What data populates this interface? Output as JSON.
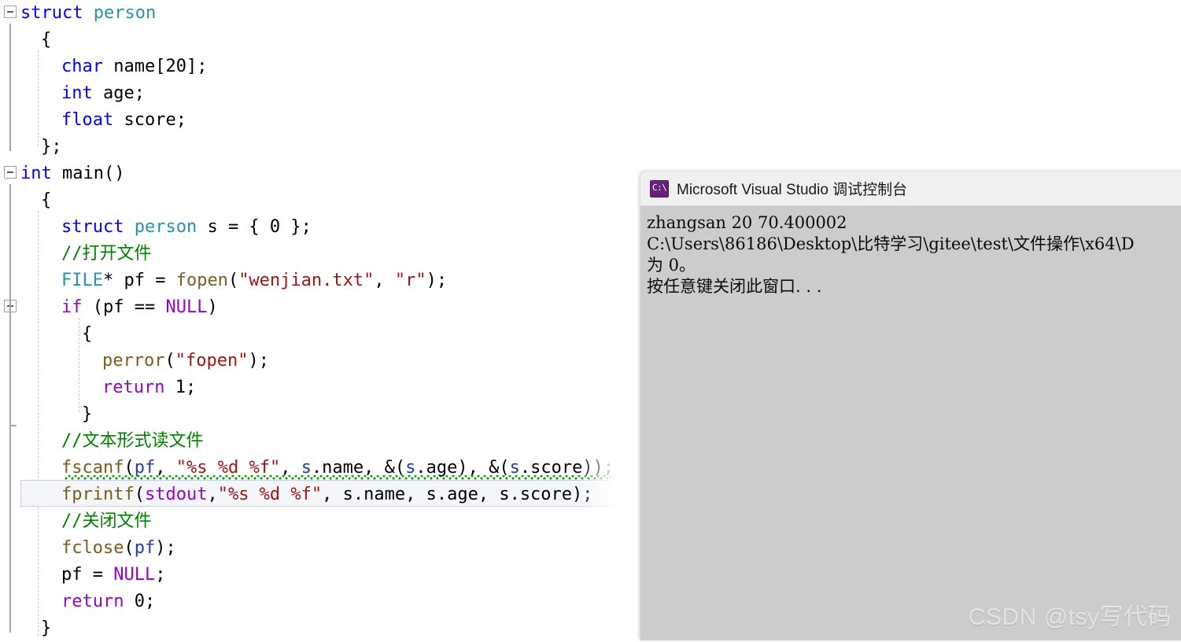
{
  "editor": {
    "name": "visual-studio-code-editor",
    "background": "#ffffff",
    "font_size_px": 22,
    "line_height_px": 34,
    "lines": [
      {
        "indent": 0,
        "tokens": [
          {
            "t": "struct ",
            "c": "kw"
          },
          {
            "t": "person",
            "c": "type"
          }
        ]
      },
      {
        "indent": 1,
        "tokens": [
          {
            "t": "{",
            "c": "plain"
          }
        ]
      },
      {
        "indent": 2,
        "tokens": [
          {
            "t": "char ",
            "c": "kw"
          },
          {
            "t": "name[",
            "c": "plain"
          },
          {
            "t": "20",
            "c": "num"
          },
          {
            "t": "];",
            "c": "plain"
          }
        ]
      },
      {
        "indent": 2,
        "tokens": [
          {
            "t": "int ",
            "c": "kw"
          },
          {
            "t": "age;",
            "c": "plain"
          }
        ]
      },
      {
        "indent": 2,
        "tokens": [
          {
            "t": "float ",
            "c": "kw"
          },
          {
            "t": "score;",
            "c": "plain"
          }
        ]
      },
      {
        "indent": 1,
        "tokens": [
          {
            "t": "};",
            "c": "plain"
          }
        ]
      },
      {
        "indent": 0,
        "tokens": [
          {
            "t": "int ",
            "c": "kw"
          },
          {
            "t": "main",
            "c": "plain"
          },
          {
            "t": "()",
            "c": "plain"
          }
        ]
      },
      {
        "indent": 1,
        "tokens": [
          {
            "t": "{",
            "c": "plain"
          }
        ]
      },
      {
        "indent": 2,
        "tokens": [
          {
            "t": "struct ",
            "c": "kw"
          },
          {
            "t": "person",
            "c": "type"
          },
          {
            "t": " s = { ",
            "c": "plain"
          },
          {
            "t": "0",
            "c": "num"
          },
          {
            "t": " };",
            "c": "plain"
          }
        ]
      },
      {
        "indent": 2,
        "tokens": [
          {
            "t": "//打开文件",
            "c": "cmt"
          }
        ]
      },
      {
        "indent": 2,
        "tokens": [
          {
            "t": "FILE",
            "c": "type"
          },
          {
            "t": "* pf = ",
            "c": "plain"
          },
          {
            "t": "fopen",
            "c": "fn"
          },
          {
            "t": "(",
            "c": "plain"
          },
          {
            "t": "\"wenjian.txt\"",
            "c": "str"
          },
          {
            "t": ", ",
            "c": "plain"
          },
          {
            "t": "\"r\"",
            "c": "str"
          },
          {
            "t": ");",
            "c": "plain"
          }
        ]
      },
      {
        "indent": 2,
        "tokens": [
          {
            "t": "if ",
            "c": "ctl"
          },
          {
            "t": "(pf == ",
            "c": "plain"
          },
          {
            "t": "NULL",
            "c": "macro"
          },
          {
            "t": ")",
            "c": "plain"
          }
        ]
      },
      {
        "indent": 3,
        "tokens": [
          {
            "t": "{",
            "c": "plain"
          }
        ]
      },
      {
        "indent": 4,
        "tokens": [
          {
            "t": "perror",
            "c": "fn"
          },
          {
            "t": "(",
            "c": "plain"
          },
          {
            "t": "\"fopen\"",
            "c": "str"
          },
          {
            "t": ");",
            "c": "plain"
          }
        ]
      },
      {
        "indent": 4,
        "tokens": [
          {
            "t": "return ",
            "c": "ctl"
          },
          {
            "t": "1",
            "c": "num"
          },
          {
            "t": ";",
            "c": "plain"
          }
        ]
      },
      {
        "indent": 3,
        "tokens": [
          {
            "t": "}",
            "c": "plain"
          }
        ]
      },
      {
        "indent": 2,
        "tokens": [
          {
            "t": "//文本形式读文件",
            "c": "cmt"
          }
        ]
      },
      {
        "indent": 2,
        "tokens": [
          {
            "t": "fscanf",
            "c": "fn"
          },
          {
            "t": "(",
            "c": "plain"
          },
          {
            "t": "pf",
            "c": "var"
          },
          {
            "t": ", ",
            "c": "plain"
          },
          {
            "t": "\"%s %d %f\"",
            "c": "str"
          },
          {
            "t": ", ",
            "c": "plain"
          },
          {
            "t": "s",
            "c": "var"
          },
          {
            "t": ".name, &(",
            "c": "plain"
          },
          {
            "t": "s",
            "c": "var"
          },
          {
            "t": ".age), &(",
            "c": "plain"
          },
          {
            "t": "s",
            "c": "var"
          },
          {
            "t": ".score));",
            "c": "plain"
          }
        ]
      },
      {
        "indent": 2,
        "tokens": [
          {
            "t": "fprintf",
            "c": "fn"
          },
          {
            "t": "(",
            "c": "plain"
          },
          {
            "t": "stdout",
            "c": "macro"
          },
          {
            "t": ",",
            "c": "plain"
          },
          {
            "t": "\"%s %d %f\"",
            "c": "str"
          },
          {
            "t": ", s.name, s.age, s.score);",
            "c": "plain"
          }
        ]
      },
      {
        "indent": 2,
        "tokens": [
          {
            "t": "//关闭文件",
            "c": "cmt"
          }
        ]
      },
      {
        "indent": 2,
        "tokens": [
          {
            "t": "fclose",
            "c": "fn"
          },
          {
            "t": "(",
            "c": "plain"
          },
          {
            "t": "pf",
            "c": "var"
          },
          {
            "t": ");",
            "c": "plain"
          }
        ]
      },
      {
        "indent": 2,
        "tokens": [
          {
            "t": "pf = ",
            "c": "plain"
          },
          {
            "t": "NULL",
            "c": "macro"
          },
          {
            "t": ";",
            "c": "plain"
          }
        ]
      },
      {
        "indent": 2,
        "tokens": [
          {
            "t": "return ",
            "c": "ctl"
          },
          {
            "t": "0",
            "c": "num"
          },
          {
            "t": ";",
            "c": "plain"
          }
        ]
      },
      {
        "indent": 1,
        "tokens": [
          {
            "t": "}",
            "c": "plain"
          }
        ]
      }
    ],
    "outline_collapse_rows": [
      0,
      6,
      11
    ],
    "current_line_row": 18,
    "squiggle_row": 17
  },
  "console": {
    "window_name": "visual-studio-debug-console",
    "icon_label": "C:\\",
    "title": "Microsoft Visual Studio 调试控制台",
    "background": "#cccccc",
    "titlebar_background": "#f0f0f0",
    "output_lines": [
      "zhangsan 20 70.400002",
      "C:\\Users\\86186\\Desktop\\比特学习\\gitee\\test\\文件操作\\x64\\D",
      "为 0。",
      "按任意键关闭此窗口. . ."
    ]
  },
  "watermark": {
    "text": "CSDN @tsy写代码"
  }
}
